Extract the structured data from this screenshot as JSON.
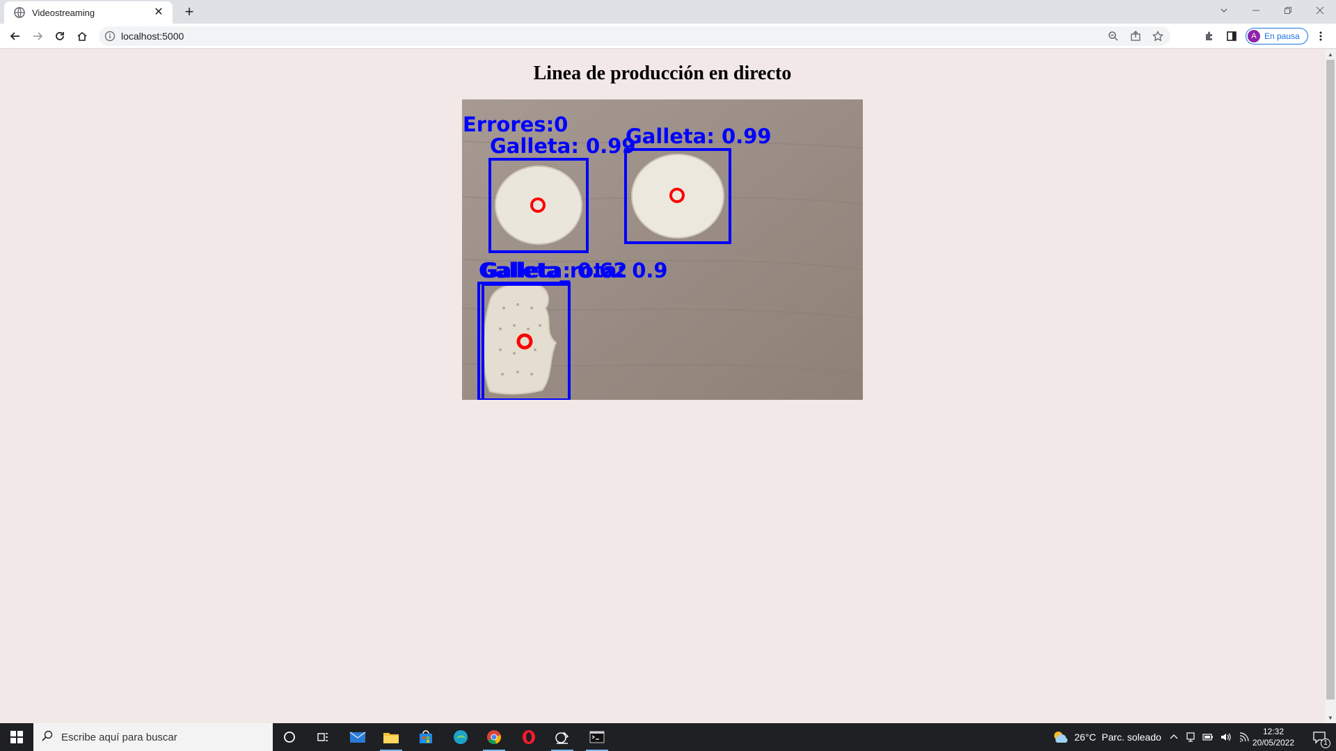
{
  "browser": {
    "tab_title": "Videostreaming",
    "tab_close": "✕",
    "new_tab": "+",
    "url": "localhost:5000",
    "profile_initial": "A",
    "profile_label": "En pausa"
  },
  "page": {
    "title": "Linea de producción en directo"
  },
  "stream": {
    "error_count_label": "Errores:0",
    "detections": [
      {
        "label": "Galleta: 0.99"
      },
      {
        "label": "Galleta: 0.99"
      },
      {
        "label": "Galleta_rota: 0.9"
      },
      {
        "label": "Galleta: 0.62"
      }
    ],
    "box_color": "#0000ff",
    "center_marker_color": "#ff0000"
  },
  "taskbar": {
    "search_placeholder": "Escribe aquí para buscar",
    "weather_temp": "26°C",
    "weather_desc": "Parc. soleado",
    "time": "12:32",
    "date": "20/05/2022",
    "notification_count": "1"
  }
}
